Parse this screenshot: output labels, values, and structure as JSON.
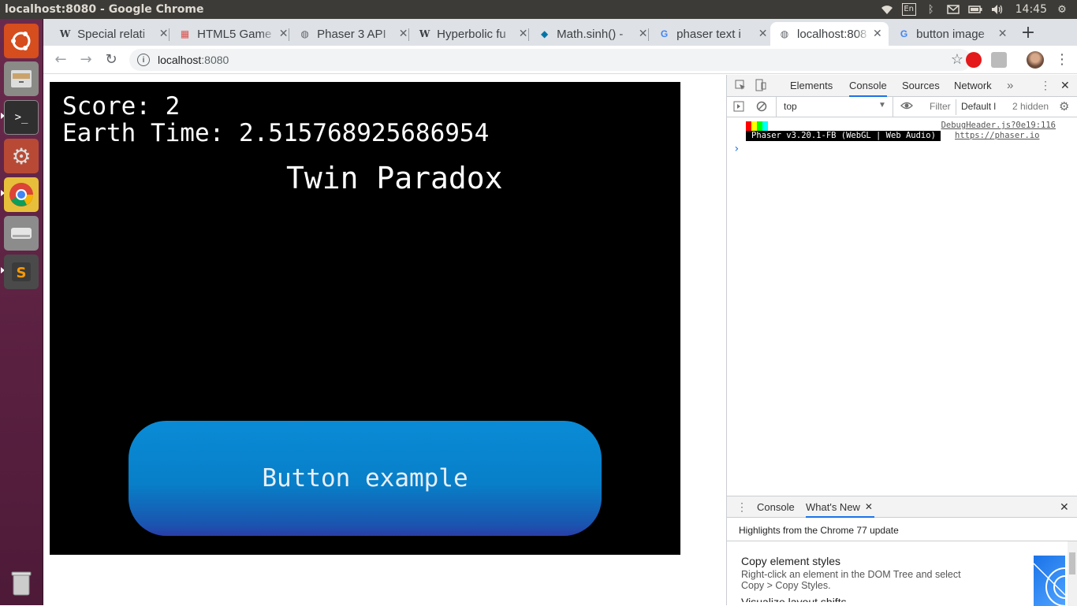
{
  "window": {
    "title": "localhost:8080 - Google Chrome"
  },
  "system_tray": {
    "keyboard": "En",
    "clock": "14:45"
  },
  "launcher": {
    "items": [
      {
        "icon": "ubuntu-logo-icon"
      },
      {
        "icon": "files-icon"
      },
      {
        "icon": "terminal-icon"
      },
      {
        "icon": "settings-icon"
      },
      {
        "icon": "chrome-icon"
      },
      {
        "icon": "drive-icon"
      },
      {
        "icon": "sublime-text-icon"
      },
      {
        "icon": "trash-icon"
      }
    ]
  },
  "tabs": [
    {
      "label": "Special relati",
      "favicon": "W"
    },
    {
      "label": "HTML5 Game",
      "favicon": "▦"
    },
    {
      "label": "Phaser 3 API",
      "favicon": "◍"
    },
    {
      "label": "Hyperbolic fu",
      "favicon": "W"
    },
    {
      "label": "Math.sinh() -",
      "favicon": "◆"
    },
    {
      "label": "phaser text i",
      "favicon": "G"
    },
    {
      "label": "localhost:808",
      "favicon": "◍"
    },
    {
      "label": "button image",
      "favicon": "G"
    }
  ],
  "address_bar": {
    "host": "localhost",
    "port": ":8080"
  },
  "game": {
    "score_text": "Score: 2",
    "earth_time_text": "Earth Time: 2.515768925686954",
    "title": "Twin Paradox",
    "button_label": "Button example"
  },
  "devtools": {
    "tabs": [
      "Elements",
      "Console",
      "Sources",
      "Network"
    ],
    "active_tab": "Console",
    "context": "top",
    "filter_placeholder": "Filter",
    "levels": "Default l",
    "hidden_count": "2 hidden",
    "log": {
      "source": "DebugHeader.js?0e19:116",
      "message": "Phaser v3.20.1-FB (WebGL | Web Audio)",
      "link": "https://phaser.io"
    },
    "prompt": "›",
    "drawer": {
      "tabs": [
        "Console",
        "What's New"
      ],
      "heading": "Highlights from the Chrome 77 update",
      "item_title": "Copy element styles",
      "item_desc_1": "Right-click an element in the DOM Tree and select",
      "item_desc_2": "Copy > Copy Styles.",
      "item_next": "Visualize layout shifts"
    }
  }
}
